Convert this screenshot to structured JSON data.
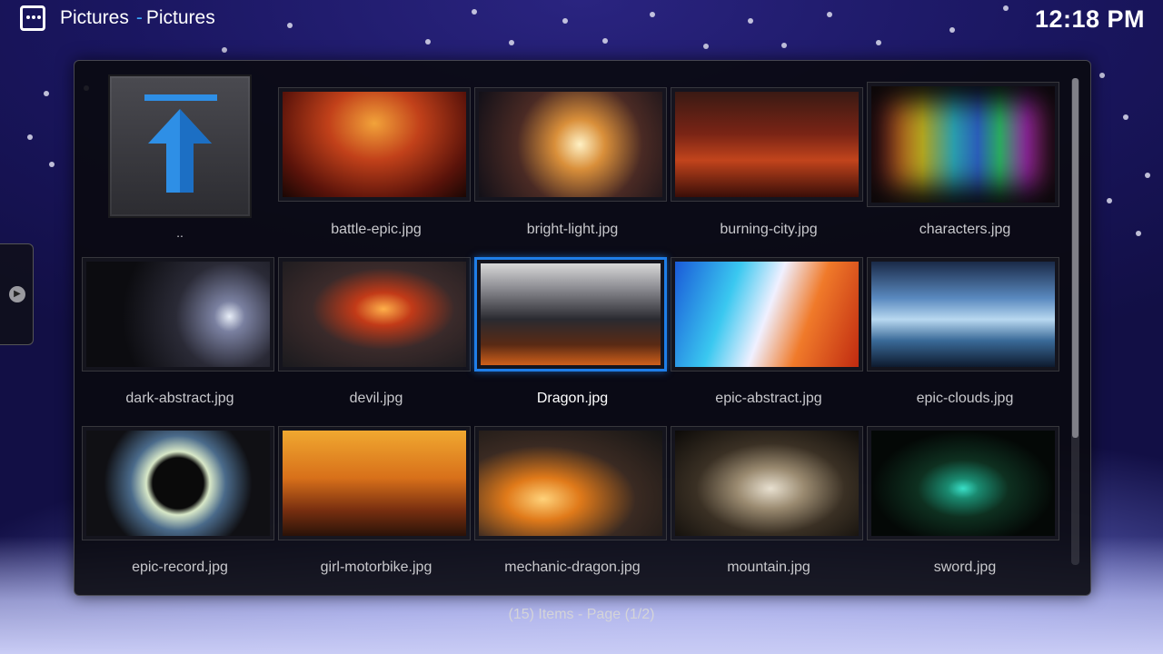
{
  "header": {
    "section": "Pictures",
    "separator": "-",
    "folder": "Pictures",
    "clock": "12:18 PM"
  },
  "up_folder": {
    "label": "..",
    "icon": "up-arrow-icon"
  },
  "items": [
    {
      "label": "battle-epic.jpg"
    },
    {
      "label": "bright-light.jpg"
    },
    {
      "label": "burning-city.jpg"
    },
    {
      "label": "characters.jpg"
    },
    {
      "label": "dark-abstract.jpg"
    },
    {
      "label": "devil.jpg"
    },
    {
      "label": "Dragon.jpg"
    },
    {
      "label": "epic-abstract.jpg"
    },
    {
      "label": "epic-clouds.jpg"
    },
    {
      "label": "epic-record.jpg"
    },
    {
      "label": "girl-motorbike.jpg"
    },
    {
      "label": "mechanic-dragon.jpg"
    },
    {
      "label": "mountain.jpg"
    },
    {
      "label": "sword.jpg"
    }
  ],
  "footer": {
    "text": "(15) Items - Page (1/2)"
  },
  "colors": {
    "accent": "#1f7ee8",
    "highlight": "#39a8ff"
  }
}
